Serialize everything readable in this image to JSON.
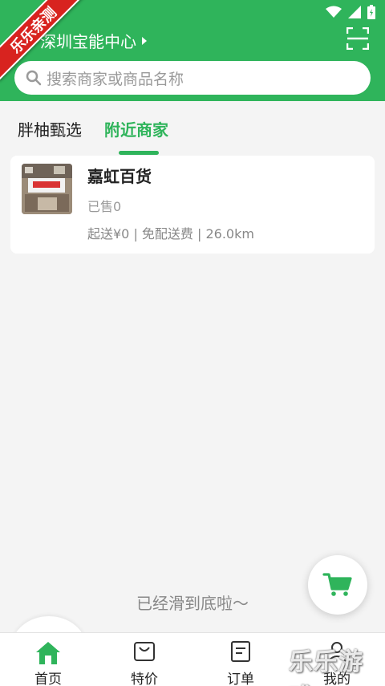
{
  "ribbon": {
    "text": "乐乐亲测"
  },
  "header": {
    "location": "深圳宝能中心",
    "search_placeholder": "搜索商家或商品名称"
  },
  "tabs": [
    {
      "label": "胖柚甄选",
      "active": false
    },
    {
      "label": "附近商家",
      "active": true
    }
  ],
  "store": {
    "name": "嘉虹百货",
    "sold": "已售0",
    "meta": "起送¥0 | 免配送费 | 26.0km"
  },
  "end_text": "已经滑到底啦～",
  "bottom_nav": [
    {
      "label": "首页",
      "icon": "home-icon",
      "active": true
    },
    {
      "label": "特价",
      "icon": "shopping-bag-icon",
      "active": false
    },
    {
      "label": "订单",
      "icon": "order-list-icon",
      "active": false
    },
    {
      "label": "我的",
      "icon": "profile-icon",
      "active": false
    }
  ],
  "watermark": {
    "text": "乐乐游戏"
  },
  "colors": {
    "brand": "#2fb45b",
    "ribbon": "#d8231f"
  }
}
